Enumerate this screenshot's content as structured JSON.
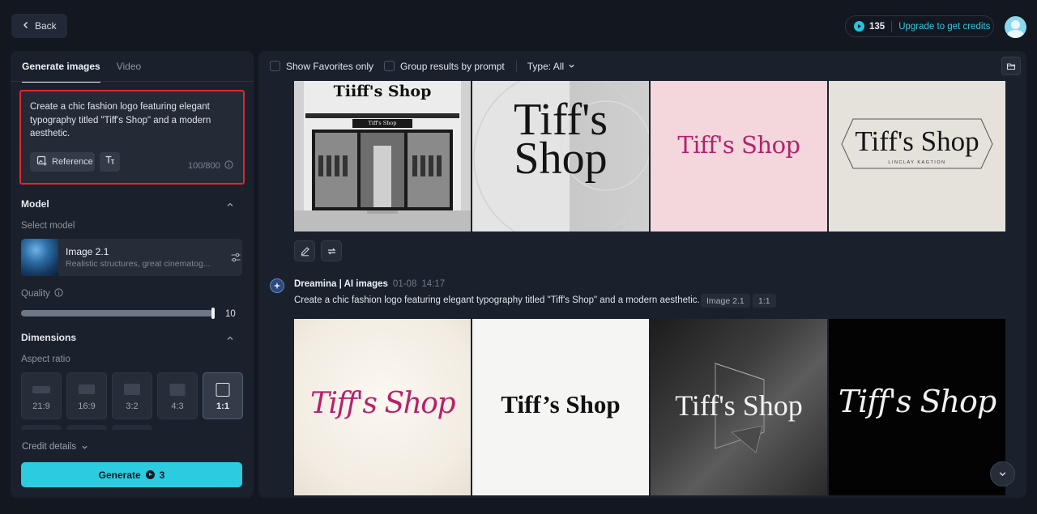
{
  "topbar": {
    "back_label": "Back",
    "credits_count": "135",
    "upgrade_label": "Upgrade to get credits"
  },
  "left": {
    "tabs": [
      {
        "label": "Generate images",
        "active": true
      },
      {
        "label": "Video",
        "active": false
      }
    ],
    "prompt": "Create a chic fashion logo featuring elegant typography titled \"Tiff's Shop\" and a modern aesthetic.",
    "reference_label": "Reference",
    "char_count": "100/800",
    "model_section": "Model",
    "select_model_label": "Select model",
    "model_name": "Image 2.1",
    "model_desc": "Realistic structures, great cinematog...",
    "quality_label": "Quality",
    "quality_value": "10",
    "quality_fraction": 0.95,
    "dimensions_section": "Dimensions",
    "aspect_ratio_label": "Aspect ratio",
    "ratios": [
      {
        "label": "21:9",
        "active": false
      },
      {
        "label": "16:9",
        "active": false
      },
      {
        "label": "3:2",
        "active": false
      },
      {
        "label": "4:3",
        "active": false
      },
      {
        "label": "1:1",
        "active": true
      }
    ],
    "credit_details_label": "Credit details",
    "generate_label": "Generate",
    "generate_cost": "3"
  },
  "right": {
    "filters": {
      "favorites_label": "Show Favorites only",
      "group_label": "Group results by prompt",
      "type_label": "Type: All"
    },
    "top_row": [
      {
        "title": "Tiiff's Shop",
        "sign": "Tiff's Shop"
      },
      {
        "text_line1": "Tiff's",
        "text_line2": "Shop"
      },
      {
        "text": "Tiff's Shop"
      },
      {
        "text": "Tiff's Shop",
        "tagline": "LINCLAY KAGTION"
      }
    ],
    "generation": {
      "author": "Dreamina | AI images",
      "date": "01-08",
      "time": "14:17",
      "prompt": "Create a chic fashion logo featuring elegant typography titled \"Tiff's Shop\" and a modern aesthetic.",
      "model_tag": "Image 2.1",
      "ratio_tag": "1:1"
    },
    "bottom_row": [
      {
        "text": "Tiff's Shop"
      },
      {
        "text": "Tiff’s Shop"
      },
      {
        "text": "Tiff's Shop"
      },
      {
        "text": "Tiff's Shop"
      }
    ]
  },
  "colors": {
    "accent": "#2ccbe0",
    "highlight_border": "#e0262c",
    "background": "#121720",
    "panel": "#1b212c"
  }
}
